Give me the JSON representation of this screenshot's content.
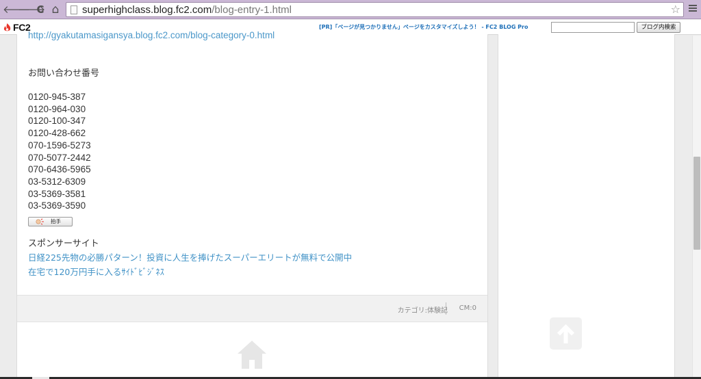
{
  "browser": {
    "url_host": "superhighclass.blog.fc2.com",
    "url_path": "/blog-entry-1.html",
    "back_glyph": "🡐",
    "forward_glyph": "🡒",
    "reload_glyph": "C",
    "home_glyph": "⌂",
    "star_glyph": "☆"
  },
  "fc2_bar": {
    "logo_text": "FC2",
    "pr_link": "[PR]「ページが見つかりません」ページをカスタマイズしよう！ - FC2 BLOG Pro",
    "search_placeholder": "",
    "search_button": "ブログ内検索"
  },
  "entry": {
    "link": "http://gyakutamasigansya.blog.fc2.com/blog-category-0.html",
    "contact_heading": "お問い合わせ番号",
    "phones": [
      "0120-945-387",
      "0120-964-030",
      "0120-100-347",
      "0120-428-662",
      "070-1596-5273",
      "070-5077-2442",
      "070-6436-5965",
      "03-5312-6309",
      "03-5369-3581",
      "03-5369-3590"
    ],
    "clap_label": "拍手",
    "sponsor_heading": "スポンサーサイト",
    "sponsor_links": [
      "日経225先物の必勝パターン！投資に人生を捧げたスーパーエリートが無料で公開中",
      "在宅で120万円手に入るｻｲﾄﾞﾋﾞｼﾞﾈｽ"
    ],
    "category": "カテゴリ:体験記",
    "comments": "CM:0"
  },
  "colors": {
    "chrome": "#cbb8d6",
    "link": "#4a97c9",
    "fc2_red": "#e8372c"
  }
}
